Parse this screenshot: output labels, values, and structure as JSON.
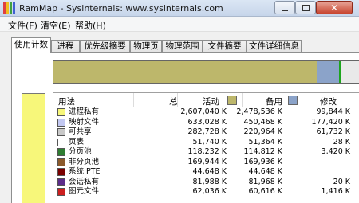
{
  "window": {
    "title": "RamMap - Sysinternals: www.sysinternals.com",
    "close_glyph": "✕"
  },
  "menu": [
    "文件(F)",
    "清空(E)",
    "帮助(H)"
  ],
  "tabs": [
    "使用计数",
    "进程",
    "优先级摘要",
    "物理页",
    "物理范围",
    "文件摘要",
    "文件详细信息"
  ],
  "colors": {
    "active": "#bdb76b",
    "standby": "#8ba3c9",
    "accent_green": "#00c000",
    "private": "#f7f77a"
  },
  "usage_bar": [
    {
      "color": "#bdb76b",
      "fraction": 0.862
    },
    {
      "color": "#8ba3c9",
      "fraction": 0.072
    },
    {
      "color": "#1da51d",
      "fraction": 0.008
    },
    {
      "color": "#e9e9e9",
      "fraction": 0.058
    }
  ],
  "table": {
    "headers": {
      "usage": "用法",
      "total": "总",
      "active": "活动",
      "standby": "备用",
      "modified": "修改"
    },
    "rows": [
      {
        "color": "#f7f77a",
        "name": "进程私有",
        "total": "2,607,040 K",
        "active": "2,478,536 K",
        "standby": "99,844 K"
      },
      {
        "color": "#c2c8f2",
        "name": "映射文件",
        "total": "633,028 K",
        "active": "450,468 K",
        "standby": "177,420 K"
      },
      {
        "color": "#c9c9c9",
        "name": "可共享",
        "total": "282,728 K",
        "active": "220,964 K",
        "standby": "61,732 K"
      },
      {
        "color": "#ffffff",
        "name": "页表",
        "total": "51,740 K",
        "active": "51,364 K",
        "standby": "28 K"
      },
      {
        "color": "#2e7d32",
        "name": "分页池",
        "total": "118,232 K",
        "active": "114,812 K",
        "standby": "3,420 K"
      },
      {
        "color": "#8b5a2b",
        "name": "非分页池",
        "total": "169,944 K",
        "active": "169,936 K",
        "standby": ""
      },
      {
        "color": "#7a0000",
        "name": "系统 PTE",
        "total": "44,648 K",
        "active": "44,648 K",
        "standby": ""
      },
      {
        "color": "#5b2c8a",
        "name": "会话私有",
        "total": "81,988 K",
        "active": "81,968 K",
        "standby": "20 K"
      },
      {
        "color": "#cc1f1f",
        "name": "图元文件",
        "total": "62,036 K",
        "active": "60,616 K",
        "standby": "1,416 K"
      }
    ]
  }
}
